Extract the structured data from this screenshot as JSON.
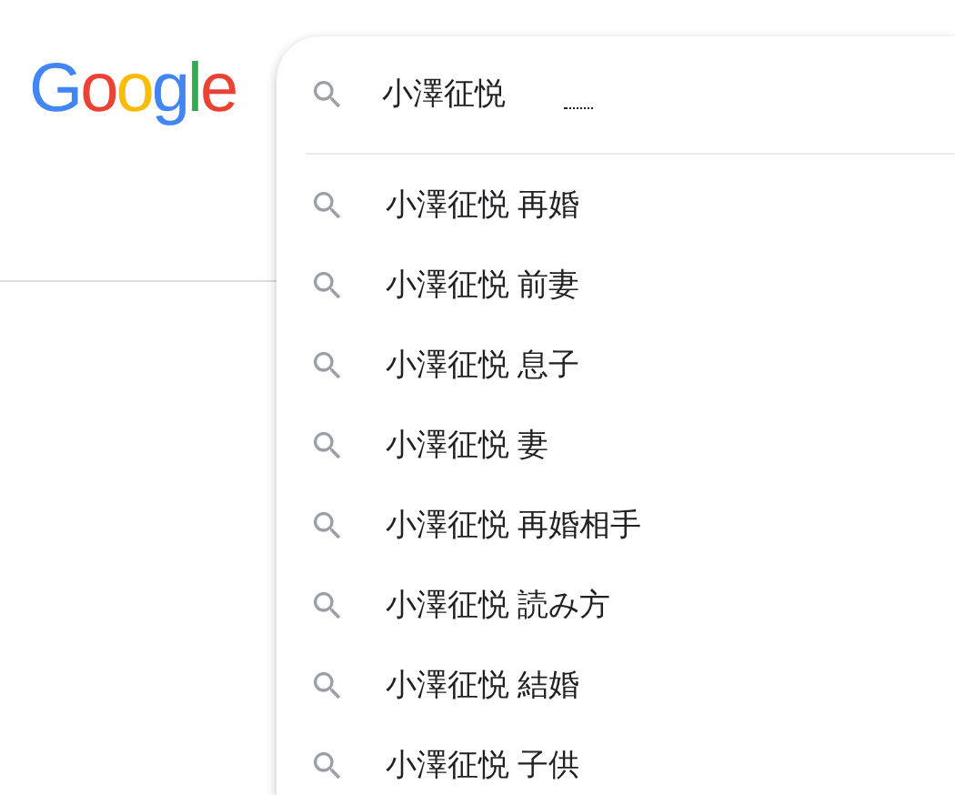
{
  "logo": "Google",
  "search": {
    "value": "小澤征悦"
  },
  "suggestions": [
    "小澤征悦 再婚",
    "小澤征悦 前妻",
    "小澤征悦 息子",
    "小澤征悦 妻",
    "小澤征悦 再婚相手",
    "小澤征悦 読み方",
    "小澤征悦 結婚",
    "小澤征悦 子供"
  ]
}
